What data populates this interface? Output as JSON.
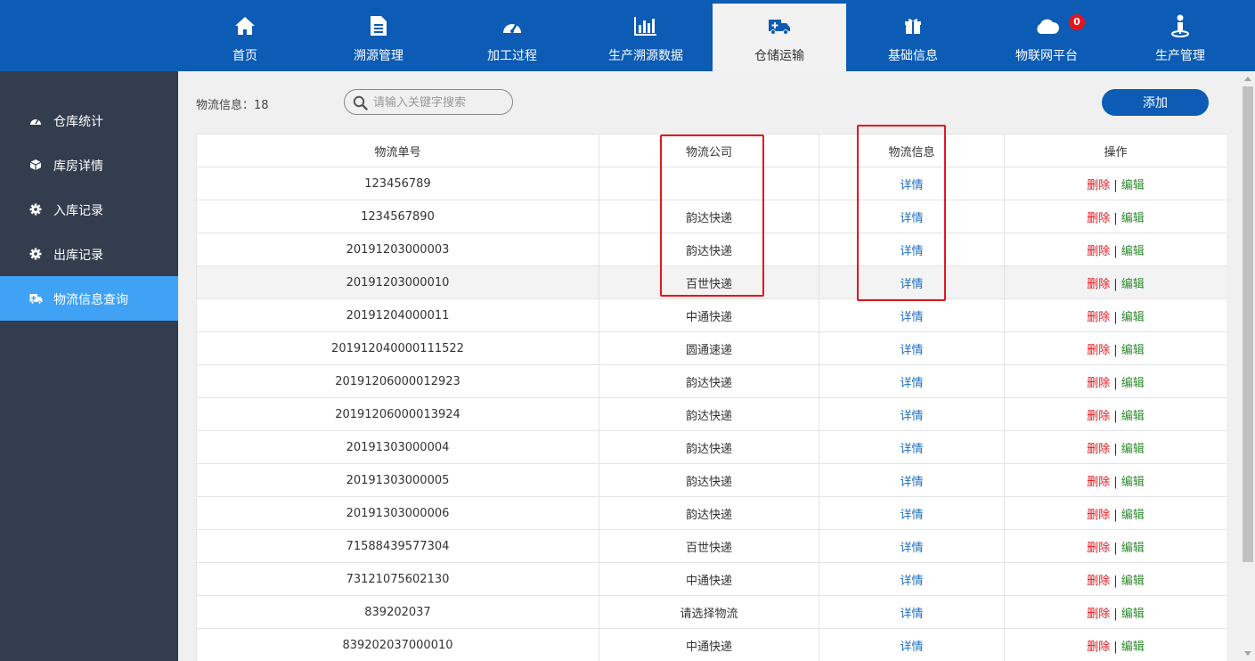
{
  "nav": {
    "items": [
      {
        "label": "首页",
        "icon": "home-icon"
      },
      {
        "label": "溯源管理",
        "icon": "document-icon"
      },
      {
        "label": "加工过程",
        "icon": "dashboard-icon"
      },
      {
        "label": "生产溯源数据",
        "icon": "bar-chart-icon"
      },
      {
        "label": "仓储运输",
        "icon": "ambulance-icon",
        "active": true
      },
      {
        "label": "基础信息",
        "icon": "gift-icon"
      },
      {
        "label": "物联网平台",
        "icon": "cloud-icon",
        "badge": "0"
      },
      {
        "label": "生产管理",
        "icon": "location-person-icon"
      }
    ]
  },
  "sidebar": {
    "items": [
      {
        "label": "仓库统计",
        "icon": "dashboard-icon"
      },
      {
        "label": "库房详情",
        "icon": "box-icon"
      },
      {
        "label": "入库记录",
        "icon": "gear-icon"
      },
      {
        "label": "出库记录",
        "icon": "gear-icon"
      },
      {
        "label": "物流信息查询",
        "icon": "ambulance-icon",
        "active": true
      }
    ]
  },
  "toolbar": {
    "info_label": "物流信息：",
    "count": "18",
    "search_placeholder": "请输入关键字搜索",
    "add_label": "添加"
  },
  "table": {
    "headers": [
      "物流单号",
      "物流公司",
      "物流信息",
      "操作"
    ],
    "detail_label": "详情",
    "delete_label": "删除",
    "separator": "|",
    "edit_label": "编辑",
    "rows": [
      {
        "id": "123456789",
        "company": ""
      },
      {
        "id": "1234567890",
        "company": "韵达快递"
      },
      {
        "id": "20191203000003",
        "company": "韵达快递"
      },
      {
        "id": "20191203000010",
        "company": "百世快递"
      },
      {
        "id": "20191204000011",
        "company": "中通快递"
      },
      {
        "id": "201912040000111522",
        "company": "圆通速递"
      },
      {
        "id": "20191206000012923",
        "company": "韵达快递"
      },
      {
        "id": "20191206000013924",
        "company": "韵达快递"
      },
      {
        "id": "20191303000004",
        "company": "韵达快递"
      },
      {
        "id": "20191303000005",
        "company": "韵达快递"
      },
      {
        "id": "20191303000006",
        "company": "韵达快递"
      },
      {
        "id": "71588439577304",
        "company": "百世快递"
      },
      {
        "id": "73121075602130",
        "company": "中通快递"
      },
      {
        "id": "839202037",
        "company": "请选择物流"
      },
      {
        "id": "839202037000010",
        "company": "中通快递"
      }
    ]
  },
  "colors": {
    "nav_bg": "#0c5bb5",
    "sidebar_bg": "#333d4e",
    "sidebar_active": "#3fa2f5",
    "highlight_border": "#e5141c",
    "delete": "#e5141c",
    "edit": "#2e8b2e",
    "detail": "#1d6fc1"
  }
}
